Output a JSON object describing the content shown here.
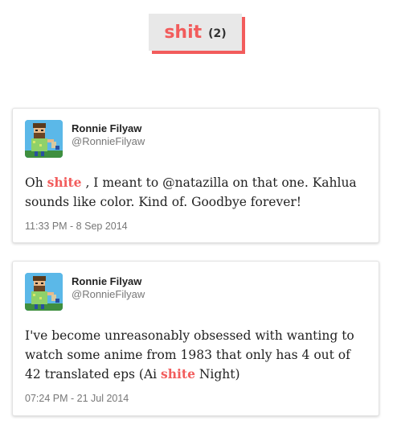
{
  "header": {
    "tag": "shit",
    "count": "(2)"
  },
  "colors": {
    "accent": "#f25c5c",
    "card_border": "#e3e3e3",
    "muted_text": "#777777"
  },
  "tweets": [
    {
      "author_name": "Ronnie Filyaw",
      "author_handle": "@RonnieFilyaw",
      "text_before": "Oh ",
      "highlight": "shite",
      "text_after": " , I meant to @natazilla on that one. Kahlua sounds like color. Kind of. Goodbye forever!",
      "timestamp": "11:33 PM - 8 Sep 2014",
      "avatar_icon": "pixel-art-avatar-icon"
    },
    {
      "author_name": "Ronnie Filyaw",
      "author_handle": "@RonnieFilyaw",
      "text_before": "I've become unreasonably obsessed with wanting to watch some anime from 1983 that only has 4 out of 42 translated eps (Ai ",
      "highlight": "shite",
      "text_after": " Night)",
      "timestamp": "07:24 PM - 21 Jul 2014",
      "avatar_icon": "pixel-art-avatar-icon"
    }
  ]
}
